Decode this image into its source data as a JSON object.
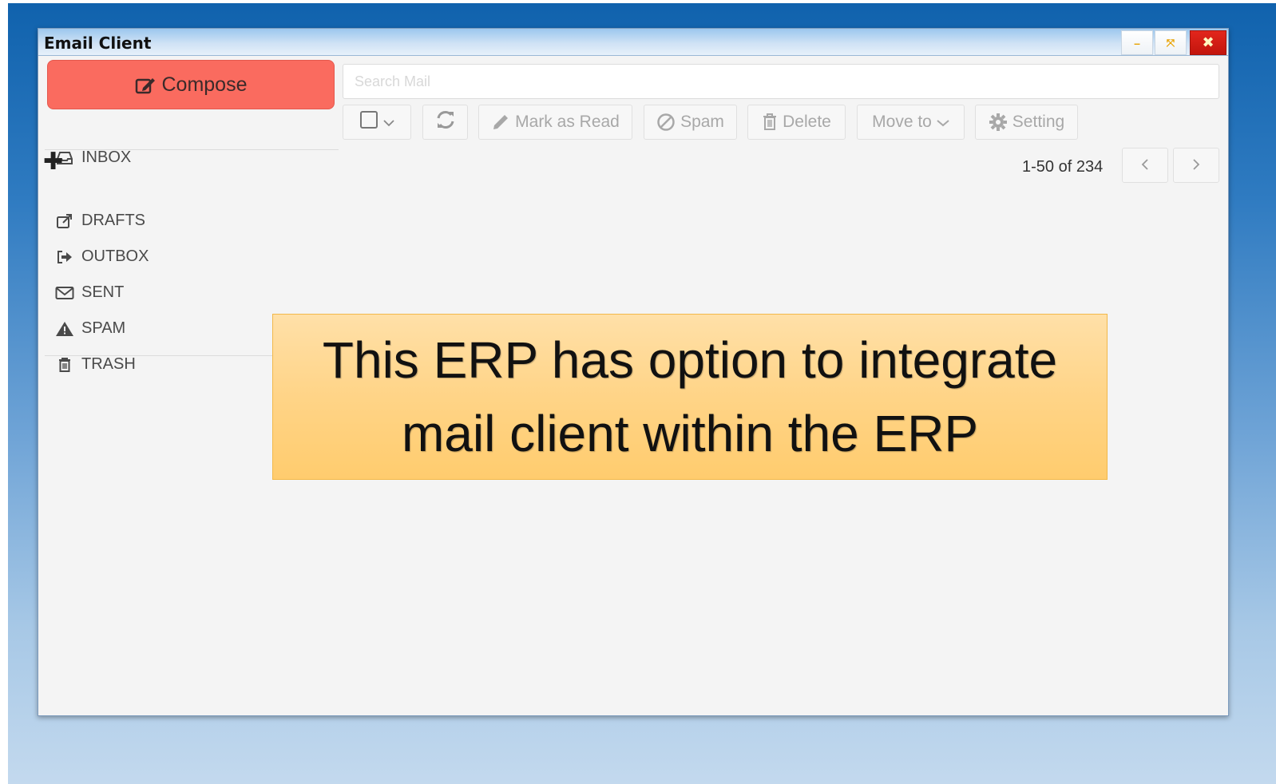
{
  "window": {
    "title": "Email Client",
    "controls": {
      "minimize": "–",
      "maximize": "⤧",
      "close": "✖"
    }
  },
  "sidebar": {
    "compose_label": "Compose",
    "add_symbol": "✚",
    "folders": [
      {
        "label": "INBOX",
        "icon": "inbox-icon"
      },
      {
        "label": "DRAFTS",
        "icon": "external-edit-icon"
      },
      {
        "label": "OUTBOX",
        "icon": "sign-out-icon"
      },
      {
        "label": "SENT",
        "icon": "envelope-icon"
      },
      {
        "label": "SPAM",
        "icon": "warning-icon"
      },
      {
        "label": "TRASH",
        "icon": "trash-icon"
      }
    ]
  },
  "search": {
    "placeholder": "Search Mail"
  },
  "toolbar": {
    "mark_read": "Mark as Read",
    "spam": "Spam",
    "delete": "Delete",
    "move_to": "Move to",
    "setting": "Setting"
  },
  "pagination": {
    "range_text": "1-50 of 234",
    "prev": "‹",
    "next": "›"
  },
  "callout": {
    "text": "This ERP has option to integrate mail client within the ERP"
  },
  "colors": {
    "compose": "#fa6b5f",
    "callout": "#ffd487",
    "close": "#d21f16"
  }
}
